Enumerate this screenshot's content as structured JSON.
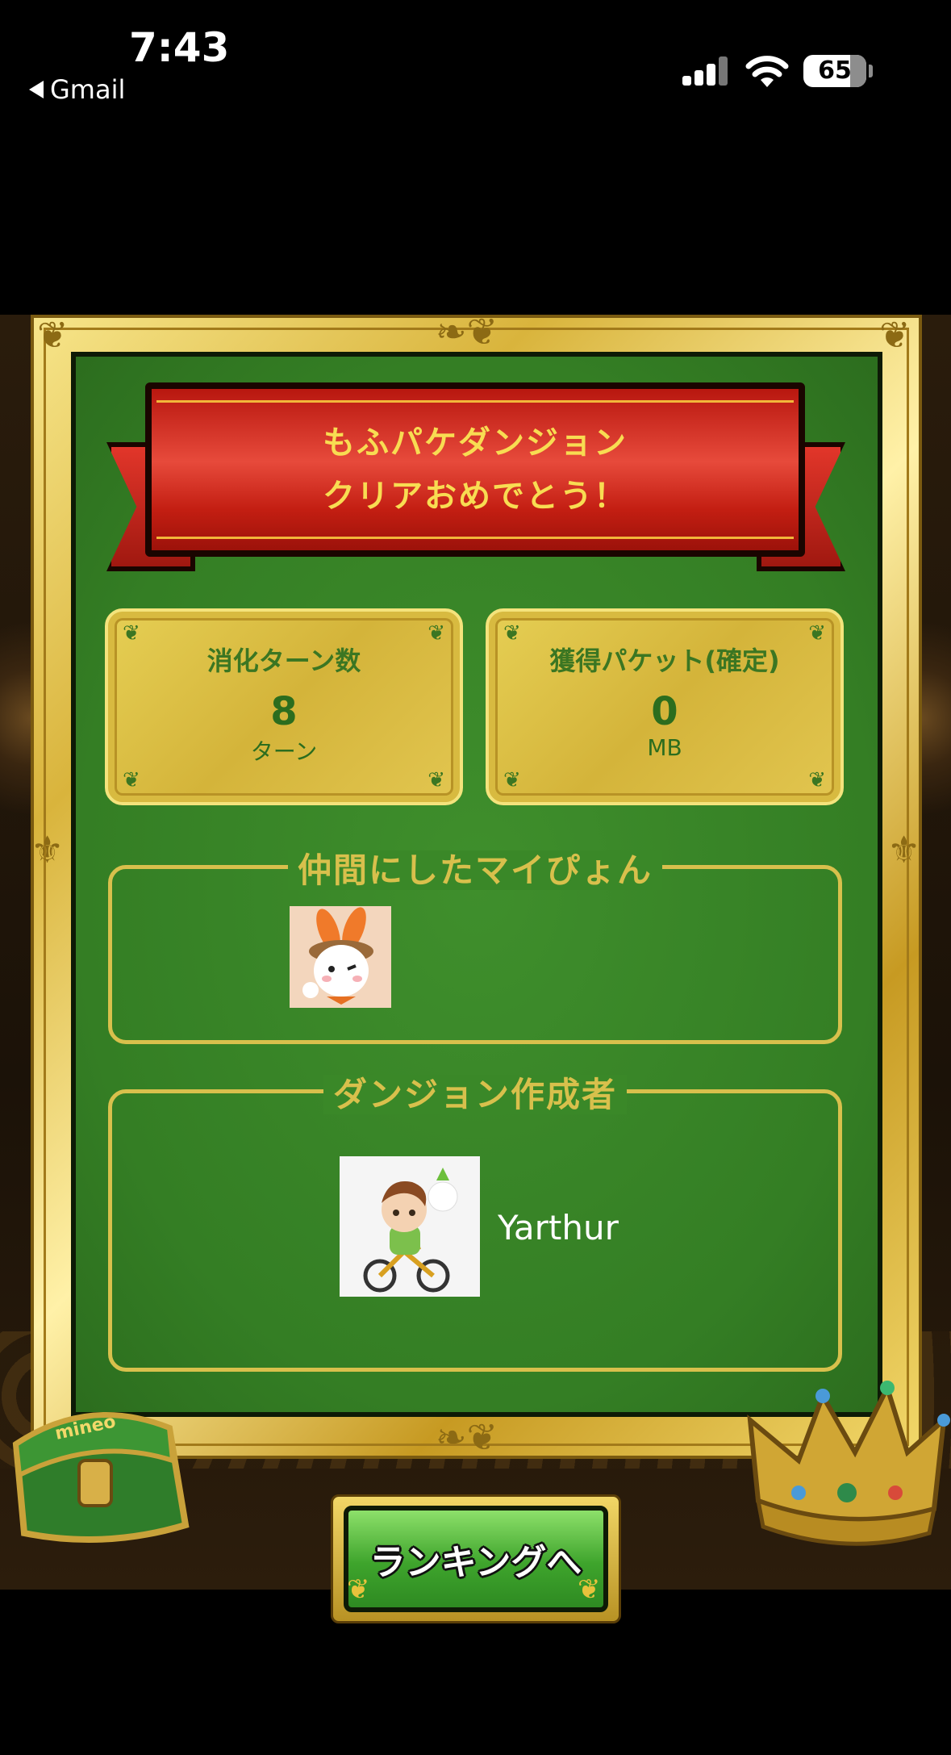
{
  "status_bar": {
    "time": "7:43",
    "back_app": "Gmail",
    "battery": "65"
  },
  "banner": {
    "line1": "もふパケダンジョン",
    "line2": "クリアおめでとう！"
  },
  "stats": {
    "turns": {
      "label": "消化ターン数",
      "value": "8",
      "unit": "ターン"
    },
    "packets": {
      "label": "獲得パケット(確定)",
      "value": "0",
      "unit": "MB"
    }
  },
  "party": {
    "title": "仲間にしたマイぴょん"
  },
  "creator": {
    "title": "ダンジョン作成者",
    "name": "Yarthur"
  },
  "chest_logo": "mineo",
  "button": {
    "label": "ランキングへ"
  },
  "colors": {
    "felt": "#347e24",
    "gold": "#d8c04c",
    "banner_red": "#c31e12",
    "banner_text": "#f8dc52",
    "button_green": "#3ea42c"
  }
}
